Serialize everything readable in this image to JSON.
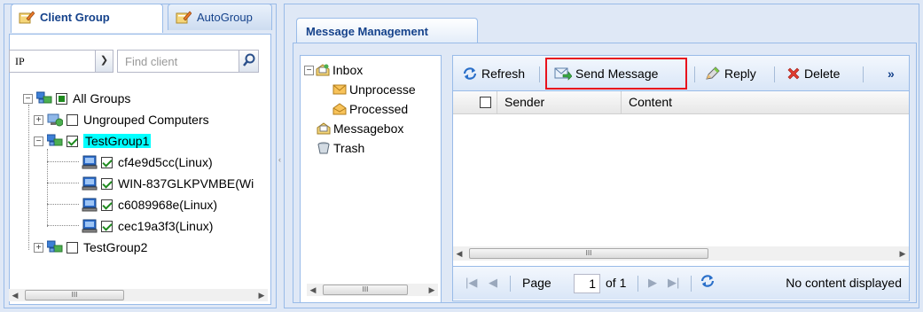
{
  "left_panel": {
    "tabs": [
      {
        "label": "Client Group",
        "active": true
      },
      {
        "label": "AutoGroup",
        "active": false
      }
    ],
    "filter": {
      "select_value": "IP",
      "search_placeholder": "Find client"
    },
    "tree": {
      "root": "All Groups",
      "groups": [
        {
          "label": "Ungrouped Computers",
          "checked": false
        },
        {
          "label": "TestGroup1",
          "checked": true,
          "selected": true,
          "clients": [
            "cf4e9d5cc(Linux)",
            "WIN-837GLKPVMBE(Wi",
            "c6089968e(Linux)",
            "cec19a3f3(Linux)"
          ]
        },
        {
          "label": "TestGroup2",
          "checked": false
        }
      ]
    },
    "scroll_thumb_label": "III"
  },
  "right_panel": {
    "tab_label": "Message Management",
    "folders": [
      "Inbox",
      "Unprocesse",
      "Processed",
      "Messagebox",
      "Trash"
    ],
    "toolbar": {
      "refresh": "Refresh",
      "send_message": "Send Message",
      "reply": "Reply",
      "delete": "Delete",
      "more": "»"
    },
    "columns": [
      "Sender",
      "Content"
    ],
    "pager": {
      "page_label": "Page",
      "page_value": "1",
      "of_label": "of 1",
      "status": "No content displayed"
    },
    "scroll_thumb_label": "III"
  },
  "colors": {
    "panel_bg": "#dfe8f6",
    "border": "#99bbe8",
    "tab_text": "#15428b",
    "highlight": "#00ffff",
    "send_message_outline": "#e8121d"
  }
}
